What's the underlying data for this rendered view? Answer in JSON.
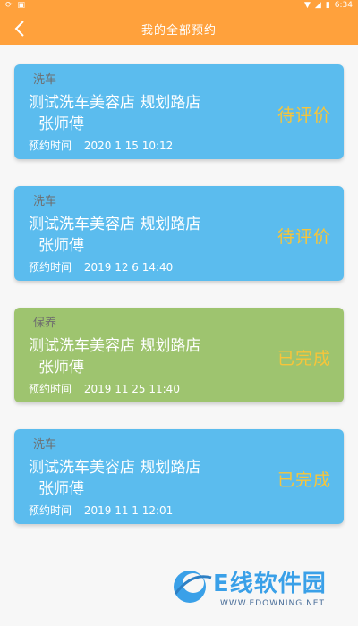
{
  "status_bar": {
    "time": "6:34",
    "left_icons": [
      "sync-icon",
      "image-icon"
    ],
    "right_icons": [
      "wifi-icon",
      "signal-icon",
      "battery-icon"
    ]
  },
  "header": {
    "title": "我的全部预约",
    "back_icon": "back-arrow-icon",
    "background": "#ffa13c"
  },
  "colors": {
    "card_blue": "#5bbcee",
    "card_green": "#9ec46f",
    "status_text": "#f7c53a"
  },
  "appointments": [
    {
      "service": "洗车",
      "shop": "测试洗车美容店  规划路店",
      "technician": "张师傅",
      "time_label": "预约时间",
      "time": "2020 1 15 10:12",
      "status": "待评价",
      "color": "blue"
    },
    {
      "service": "洗车",
      "shop": "测试洗车美容店  规划路店",
      "technician": "张师傅",
      "time_label": "预约时间",
      "time": "2019 12 6 14:40",
      "status": "待评价",
      "color": "blue"
    },
    {
      "service": "保养",
      "shop": "测试洗车美容店  规划路店",
      "technician": "张师傅",
      "time_label": "预约时间",
      "time": "2019 11 25 11:40",
      "status": "已完成",
      "color": "green"
    },
    {
      "service": "洗车",
      "shop": "测试洗车美容店  规划路店",
      "technician": "张师傅",
      "time_label": "预约时间",
      "time": "2019 11 1 12:01",
      "status": "已完成",
      "color": "blue"
    }
  ],
  "watermark": {
    "text": "E线软件园",
    "url": "WWW.EDOWNING.NET"
  }
}
